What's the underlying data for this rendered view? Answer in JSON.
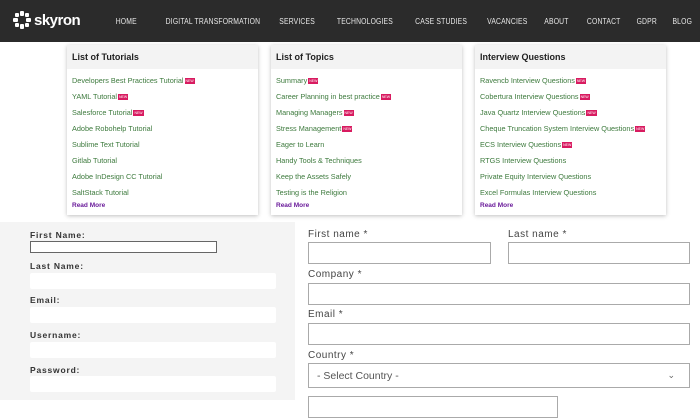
{
  "header": {
    "logo_text": "skyron",
    "nav": [
      "HOME",
      "DIGITAL TRANSFORMATION",
      "SERVICES",
      "TECHNOLOGIES",
      "CASE STUDIES",
      "VACANCIES",
      "ABOUT",
      "CONTACT",
      "GDPR",
      "BLOG"
    ]
  },
  "mega_menu": {
    "badge_label": "NEW",
    "badge_color": "#d81b60",
    "link_color": "#3d7a3d",
    "panels": [
      {
        "title": "List of Tutorials",
        "read_more": "Read More",
        "items": [
          {
            "label": "Developers Best Practices Tutorial",
            "new": true
          },
          {
            "label": "YAML Tutorial",
            "new": true
          },
          {
            "label": "Salesforce Tutorial",
            "new": true
          },
          {
            "label": "Adobe Robohelp Tutorial",
            "new": false
          },
          {
            "label": "Sublime Text Tutorial",
            "new": false
          },
          {
            "label": "Gitlab Tutorial",
            "new": false
          },
          {
            "label": "Adobe InDesign CC Tutorial",
            "new": false
          },
          {
            "label": "SaltStack Tutorial",
            "new": false
          }
        ]
      },
      {
        "title": "List of Topics",
        "read_more": "Read More",
        "items": [
          {
            "label": "Summary",
            "new": true
          },
          {
            "label": "Career Planning in best practice",
            "new": true
          },
          {
            "label": "Managing Managers",
            "new": true
          },
          {
            "label": "Stress Management",
            "new": true
          },
          {
            "label": "Eager to Learn",
            "new": false
          },
          {
            "label": "Handy Tools & Techniques",
            "new": false
          },
          {
            "label": "Keep the Assets Safely",
            "new": false
          },
          {
            "label": "Testing is the Religion",
            "new": false
          }
        ]
      },
      {
        "title": "Interview Questions",
        "read_more": "Read More",
        "items": [
          {
            "label": "Ravencb Interview Questions",
            "new": true
          },
          {
            "label": "Cobertura Interview Questions",
            "new": true
          },
          {
            "label": "Java Quartz Interview Questions",
            "new": true
          },
          {
            "label": "Cheque Truncation System Interview Questions",
            "new": true
          },
          {
            "label": "ECS Interview Questions",
            "new": true
          },
          {
            "label": "RTGS Interview Questions",
            "new": false
          },
          {
            "label": "Private Equity Interview Questions",
            "new": false
          },
          {
            "label": "Excel Formulas Interview Questions",
            "new": false
          }
        ]
      }
    ]
  },
  "left_form": {
    "first_name": "First Name:",
    "last_name": "Last Name:",
    "email": "Email:",
    "username": "Username:",
    "password": "Password:"
  },
  "right_form": {
    "first_name": "First name *",
    "last_name": "Last name *",
    "company": "Company *",
    "email": "Email *",
    "country": "Country *",
    "country_selected": "- Select Country -"
  }
}
